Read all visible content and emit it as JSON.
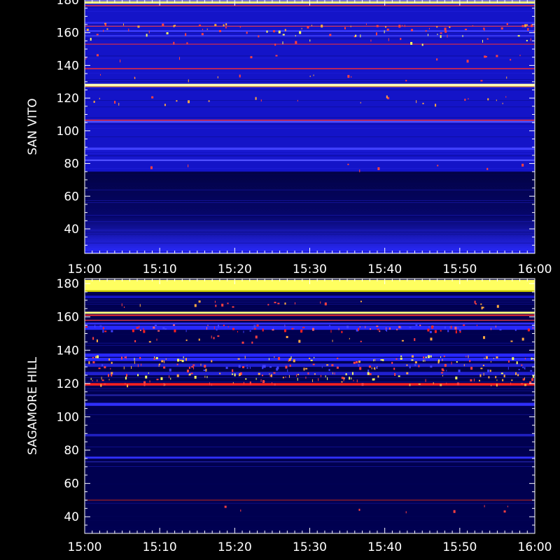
{
  "chart_data": [
    {
      "type": "heatmap",
      "ylabel": "SAN VITO",
      "xlim": [
        "15:00",
        "16:00"
      ],
      "ylim": [
        25,
        180
      ],
      "x_ticks": [
        "15:00",
        "15:10",
        "15:20",
        "15:30",
        "15:40",
        "15:50",
        "16:00"
      ],
      "y_ticks": [
        40,
        60,
        80,
        100,
        120,
        140,
        160,
        180
      ],
      "background_high": "#1414c8",
      "background_low": "#020244",
      "low_cutoff": 75,
      "bands": [
        {
          "y": 178.5,
          "color": "#ffff80",
          "w": 1.5
        },
        {
          "y": 176.5,
          "color": "#ff3030",
          "w": 0.6
        },
        {
          "y": 166,
          "color": "#3030ff",
          "w": 1
        },
        {
          "y": 164,
          "color": "#ff4040",
          "w": 0.4
        },
        {
          "y": 161,
          "color": "#4040ff",
          "w": 1
        },
        {
          "y": 158,
          "color": "#4040ff",
          "w": 0.8
        },
        {
          "y": 153,
          "color": "#ff3030",
          "w": 0.4
        },
        {
          "y": 138,
          "color": "#ff3030",
          "w": 0.6
        },
        {
          "y": 128,
          "color": "#ffffb0",
          "w": 1.5
        },
        {
          "y": 127,
          "color": "#ffaa40",
          "w": 0.5
        },
        {
          "y": 106.5,
          "color": "#ff3030",
          "w": 0.6
        },
        {
          "y": 105.5,
          "color": "#5050ff",
          "w": 1
        },
        {
          "y": 89,
          "color": "#4040ff",
          "w": 1.5
        },
        {
          "y": 82,
          "color": "#5050ff",
          "w": 1
        }
      ],
      "speckle_rows": [
        {
          "y": 164,
          "density": 0.3,
          "colors": [
            "#ff4040",
            "#ffaa40"
          ]
        },
        {
          "y": 160,
          "density": 0.2,
          "colors": [
            "#ff4040",
            "#ffff60"
          ]
        },
        {
          "y": 155,
          "density": 0.1,
          "colors": [
            "#ffff60",
            "#ff4040"
          ]
        },
        {
          "y": 145,
          "density": 0.08,
          "colors": [
            "#ff4040"
          ]
        },
        {
          "y": 133,
          "density": 0.08,
          "colors": [
            "#ff4040",
            "#ffaa40"
          ]
        },
        {
          "y": 120,
          "density": 0.1,
          "colors": [
            "#ffaa40",
            "#ff4040"
          ]
        },
        {
          "y": 118,
          "density": 0.05,
          "colors": [
            "#ffaa40"
          ]
        },
        {
          "y": 78,
          "density": 0.05,
          "colors": [
            "#ff4040"
          ]
        }
      ]
    },
    {
      "type": "heatmap",
      "ylabel": "SAGAMORE HILL",
      "xlim": [
        "15:00",
        "16:00"
      ],
      "ylim": [
        30,
        183
      ],
      "x_ticks": [
        "15:00",
        "15:10",
        "15:20",
        "15:30",
        "15:40",
        "15:50",
        "16:00"
      ],
      "y_ticks": [
        40,
        60,
        80,
        100,
        120,
        140,
        160,
        180
      ],
      "background_high": "#000050",
      "background_low": "#000050",
      "low_cutoff": 0,
      "bands": [
        {
          "y": 179,
          "color": "#ffff60",
          "w": 6.5
        },
        {
          "y": 175.5,
          "color": "#c8c800",
          "w": 1
        },
        {
          "y": 172,
          "color": "#1414c8",
          "w": 1.5
        },
        {
          "y": 162.5,
          "color": "#ffff80",
          "w": 1.2
        },
        {
          "y": 161,
          "color": "#ff3030",
          "w": 0.8
        },
        {
          "y": 158,
          "color": "#ff4040",
          "w": 0.5
        },
        {
          "y": 156,
          "color": "#3030ff",
          "w": 1.2
        },
        {
          "y": 153.5,
          "color": "#2828ff",
          "w": 2.5
        },
        {
          "y": 137,
          "color": "#2828ff",
          "w": 2
        },
        {
          "y": 134.5,
          "color": "#2828ff",
          "w": 2
        },
        {
          "y": 131,
          "color": "#2020d0",
          "w": 2
        },
        {
          "y": 126,
          "color": "#2020d0",
          "w": 2
        },
        {
          "y": 119.5,
          "color": "#ff2020",
          "w": 1.5
        },
        {
          "y": 113,
          "color": "#2020a0",
          "w": 1
        },
        {
          "y": 107.5,
          "color": "#3030ff",
          "w": 1.8
        },
        {
          "y": 89,
          "color": "#2020c0",
          "w": 1.5
        },
        {
          "y": 75.5,
          "color": "#3030ff",
          "w": 1.2
        },
        {
          "y": 73,
          "color": "#2020a0",
          "w": 0.6
        },
        {
          "y": 50,
          "color": "#a02020",
          "w": 0.5
        }
      ],
      "speckle_rows": [
        {
          "y": 168,
          "density": 0.15,
          "colors": [
            "#ff4040",
            "#ffaa40"
          ]
        },
        {
          "y": 153.5,
          "density": 0.6,
          "colors": [
            "#ff2020",
            "#ff6060",
            "#4040ff"
          ]
        },
        {
          "y": 147,
          "density": 0.15,
          "colors": [
            "#ffaa40",
            "#ff4040"
          ]
        },
        {
          "y": 135,
          "density": 0.5,
          "colors": [
            "#ffaa40",
            "#ff4040",
            "#ffff60"
          ]
        },
        {
          "y": 130,
          "density": 0.5,
          "colors": [
            "#ff4040",
            "#ffaa40",
            "#4040ff"
          ]
        },
        {
          "y": 125,
          "density": 0.5,
          "colors": [
            "#ff4040",
            "#ffaa40",
            "#ffff60"
          ]
        },
        {
          "y": 121,
          "density": 0.3,
          "colors": [
            "#ff4040",
            "#ffaa40"
          ]
        },
        {
          "y": 45,
          "density": 0.05,
          "colors": [
            "#ff4040"
          ]
        }
      ]
    }
  ]
}
